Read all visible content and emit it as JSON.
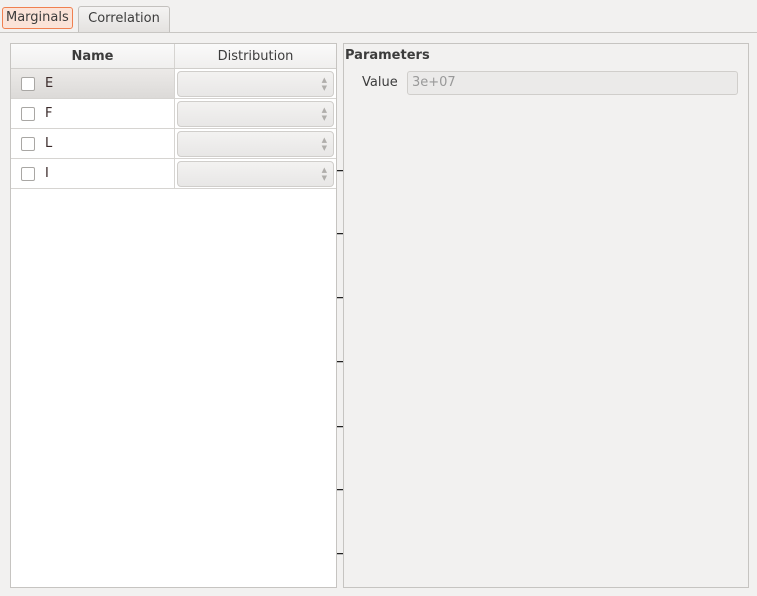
{
  "tabs": [
    {
      "label": "Marginals",
      "active": true
    },
    {
      "label": "Correlation",
      "active": false
    }
  ],
  "table": {
    "columns": [
      "Name",
      "Distribution"
    ],
    "rows": [
      {
        "name": "E",
        "checked": false,
        "distribution": ""
      },
      {
        "name": "F",
        "checked": false,
        "distribution": ""
      },
      {
        "name": "L",
        "checked": false,
        "distribution": ""
      },
      {
        "name": "I",
        "checked": false,
        "distribution": ""
      }
    ]
  },
  "parameters": {
    "title": "Parameters",
    "value_label": "Value",
    "value": "3e+07"
  },
  "colors": {
    "active_tab_border": "#f08050",
    "active_tab_bg": "#fbe3d8"
  }
}
